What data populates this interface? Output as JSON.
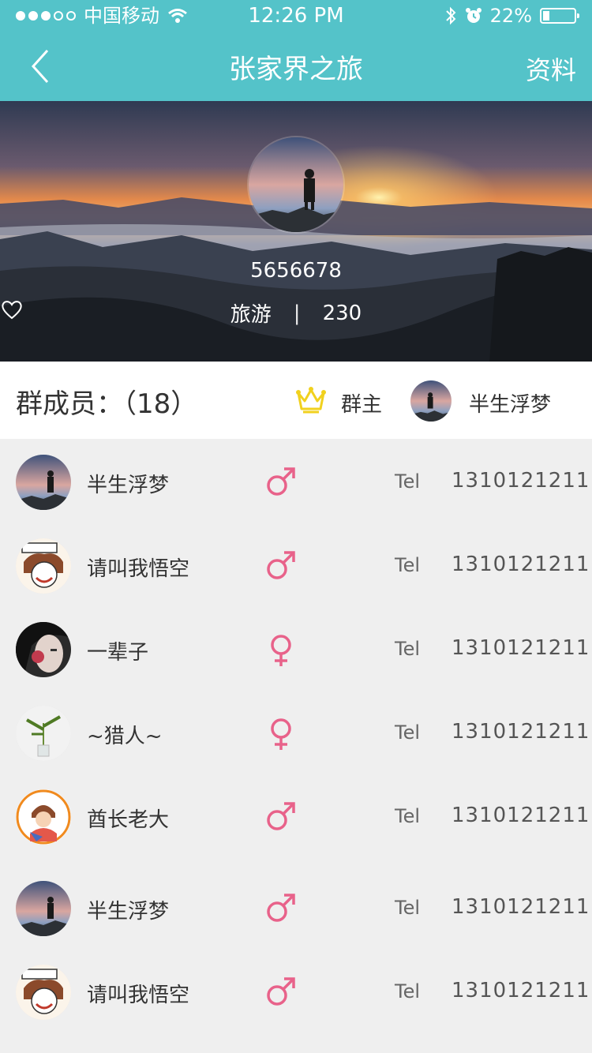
{
  "status_bar": {
    "carrier": "中国移动",
    "time": "12:26 PM",
    "battery": "22%",
    "battery_level": 0.22
  },
  "nav": {
    "title": "张家界之旅",
    "right_label": "资料"
  },
  "hero": {
    "id": "5656678",
    "tag": "旅游",
    "separator": "|",
    "likes": "230"
  },
  "members": {
    "label": "群成员：",
    "count": "（18）",
    "owner_label": "群主",
    "owner_name": "半生浮梦"
  },
  "member_list": [
    {
      "name": "半生浮梦",
      "gender": "male",
      "tel_label": "Tel",
      "phone": "1310121211",
      "avatar": "landscape"
    },
    {
      "name": "请叫我悟空",
      "gender": "male",
      "tel_label": "Tel",
      "phone": "1310121211",
      "avatar": "cartoon"
    },
    {
      "name": "一辈子",
      "gender": "female",
      "tel_label": "Tel",
      "phone": "1310121211",
      "avatar": "girl"
    },
    {
      "name": "~猎人~",
      "gender": "female",
      "tel_label": "Tel",
      "phone": "1310121211",
      "avatar": "plant"
    },
    {
      "name": "酋长老大",
      "gender": "male",
      "tel_label": "Tel",
      "phone": "1310121211",
      "avatar": "anime"
    },
    {
      "name": "半生浮梦",
      "gender": "male",
      "tel_label": "Tel",
      "phone": "1310121211",
      "avatar": "landscape"
    },
    {
      "name": "请叫我悟空",
      "gender": "male",
      "tel_label": "Tel",
      "phone": "1310121211",
      "avatar": "cartoon"
    }
  ],
  "colors": {
    "accent": "#54c3c9",
    "gender_icon": "#e8628a",
    "crown": "#f1d11e"
  }
}
